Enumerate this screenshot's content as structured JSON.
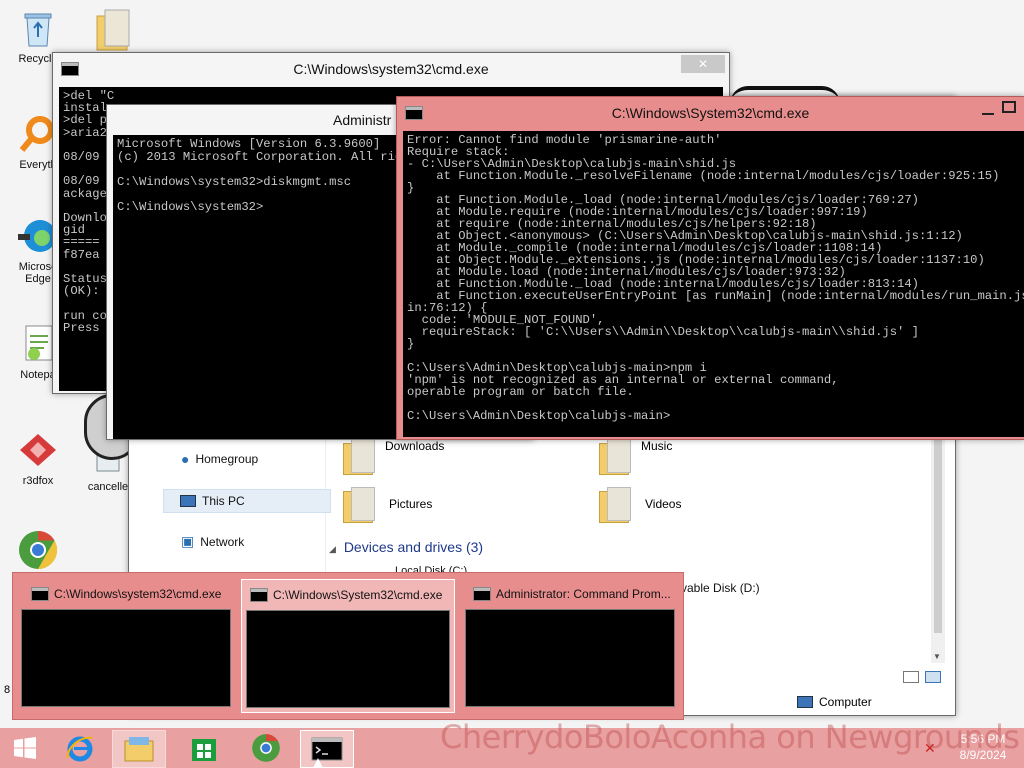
{
  "desktop": {
    "icons": [
      {
        "label": "Recycle",
        "icon": "recycle-bin-icon"
      },
      {
        "label": "Everyth",
        "icon": "everything-search-icon"
      },
      {
        "label": "Microso Edge",
        "icon": "edge-icon"
      },
      {
        "label": "Notepa",
        "icon": "notepad-icon"
      },
      {
        "label": "r3dfox",
        "icon": "r3dfox-icon"
      },
      {
        "label": "8",
        "icon": "chrome-icon"
      },
      {
        "label": "cancelle",
        "icon": "document-icon"
      }
    ]
  },
  "explorer": {
    "nav": [
      "Homegroup",
      "This PC",
      "Network"
    ],
    "folders": [
      "Downloads",
      "Music",
      "Pictures",
      "Videos"
    ],
    "section": "Devices and drives (3)",
    "drive_partial": "Local Disk (C:)",
    "drive_removable": "vable Disk (D:)",
    "status": "Computer"
  },
  "cmd1": {
    "title": "C:\\Windows\\system32\\cmd.exe",
    "lines": [
      ">del \"C",
      "instal",
      ">del p",
      ">aria2",
      "",
      "08/09",
      "",
      "08/09",
      "ackage",
      "",
      "Downlo",
      "gid",
      "=====",
      "f87ea",
      "",
      "Status",
      "(OK):",
      "",
      "run co",
      "Press"
    ]
  },
  "cmd3": {
    "title": "Administr",
    "lines": [
      "Microsoft Windows [Version 6.3.9600]",
      "(c) 2013 Microsoft Corporation. All rights reserved.",
      "",
      "C:\\Windows\\system32>diskmgmt.msc",
      "",
      "C:\\Windows\\system32>"
    ]
  },
  "cmd2": {
    "title": "C:\\Windows\\System32\\cmd.exe",
    "lines": [
      "Error: Cannot find module 'prismarine-auth'",
      "Require stack:",
      "- C:\\Users\\Admin\\Desktop\\calubjs-main\\shid.js",
      "    at Function.Module._resolveFilename (node:internal/modules/cjs/loader:925:15)",
      "}",
      "    at Function.Module._load (node:internal/modules/cjs/loader:769:27)",
      "    at Module.require (node:internal/modules/cjs/loader:997:19)",
      "    at require (node:internal/modules/cjs/helpers:92:18)",
      "    at Object.<anonymous> (C:\\Users\\Admin\\Desktop\\calubjs-main\\shid.js:1:12)",
      "    at Module._compile (node:internal/modules/cjs/loader:1108:14)",
      "    at Object.Module._extensions..js (node:internal/modules/cjs/loader:1137:10)",
      "    at Module.load (node:internal/modules/cjs/loader:973:32)",
      "    at Function.Module._load (node:internal/modules/cjs/loader:813:14)",
      "    at Function.executeUserEntryPoint [as runMain] (node:internal/modules/run_main.js:76:12) {",
      "in:76:12) {",
      "  code: 'MODULE_NOT_FOUND',",
      "  requireStack: [ 'C:\\\\Users\\\\Admin\\\\Desktop\\\\calubjs-main\\\\shid.js' ]",
      "}",
      "",
      "C:\\Users\\Admin\\Desktop\\calubjs-main>npm i",
      "'npm' is not recognized as an internal or external command,",
      "operable program or batch file.",
      "",
      "C:\\Users\\Admin\\Desktop\\calubjs-main>"
    ]
  },
  "taskbar": {
    "thumbnails": [
      {
        "title": "C:\\Windows\\system32\\cmd.exe"
      },
      {
        "title": "C:\\Windows\\System32\\cmd.exe"
      },
      {
        "title": "Administrator: Command Prom..."
      }
    ],
    "apps": [
      {
        "name": "internet-explorer-icon"
      },
      {
        "name": "file-explorer-icon"
      },
      {
        "name": "store-icon"
      },
      {
        "name": "chrome-icon"
      },
      {
        "name": "command-prompt-icon"
      }
    ],
    "time": "5:56 PM",
    "date": "8/9/2024"
  },
  "watermark": "CherrydoBoloAconha on Newgrounds",
  "colors": {
    "accent": "#e78d8d",
    "taskbar_bg": "#e9a0a0",
    "thumb_panel": "#e88d8d",
    "console_text": "#c8c8c8"
  }
}
